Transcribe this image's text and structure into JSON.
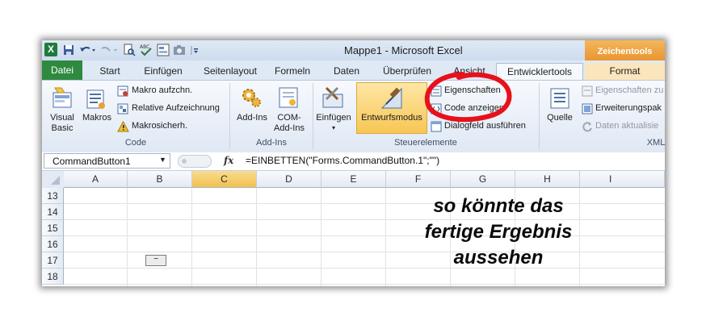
{
  "window": {
    "title": "Mappe1  -  Microsoft Excel",
    "context_header": "Zeichentools"
  },
  "tabs": [
    "Datei",
    "Start",
    "Einfügen",
    "Seitenlayout",
    "Formeln",
    "Daten",
    "Überprüfen",
    "Ansicht",
    "Entwicklertools",
    "Format"
  ],
  "ribbon": {
    "code": {
      "visual_basic": [
        "Visual",
        "Basic"
      ],
      "makros": "Makros",
      "makro_aufzeichnen": "Makro aufzchn.",
      "relative_aufzeichnung": "Relative Aufzeichnung",
      "makrosicherheit": "Makrosicherh.",
      "label": "Code"
    },
    "addins": {
      "addins": "Add-Ins",
      "com_addins": [
        "COM-",
        "Add-Ins"
      ],
      "label": "Add-Ins"
    },
    "steuerelemente": {
      "einfuegen": "Einfügen",
      "entwurfsmodus": "Entwurfsmodus",
      "eigenschaften": "Eigenschaften",
      "code_anzeigen": "Code anzeigen",
      "dialog_ausfuehren": "Dialogfeld ausführen",
      "label": "Steuerelemente"
    },
    "xml": {
      "quelle": "Quelle",
      "eigenschaften_zuordnen": "Eigenschaften zu",
      "erweiterungspakete": "Erweiterungspak",
      "daten_aktualisieren": "Daten aktualisie",
      "label": "XML"
    }
  },
  "formula_bar": {
    "name_box": "CommandButton1",
    "fx": "fx",
    "formula": "=EINBETTEN(\"Forms.CommandButton.1\";\"\")"
  },
  "columns": [
    "A",
    "B",
    "C",
    "D",
    "E",
    "F",
    "G",
    "H",
    "I"
  ],
  "rows": [
    "13",
    "14",
    "15",
    "16",
    "17",
    "18"
  ],
  "command_button_caption": "~",
  "annotation": [
    "so könnte das",
    "fertige Ergebnis",
    "aussehen"
  ],
  "colors": {
    "datei_tab": "#2d8a3f",
    "highlight": "#f8c655",
    "annotation_circle": "#e8101a",
    "context_tab": "#e8922a"
  }
}
